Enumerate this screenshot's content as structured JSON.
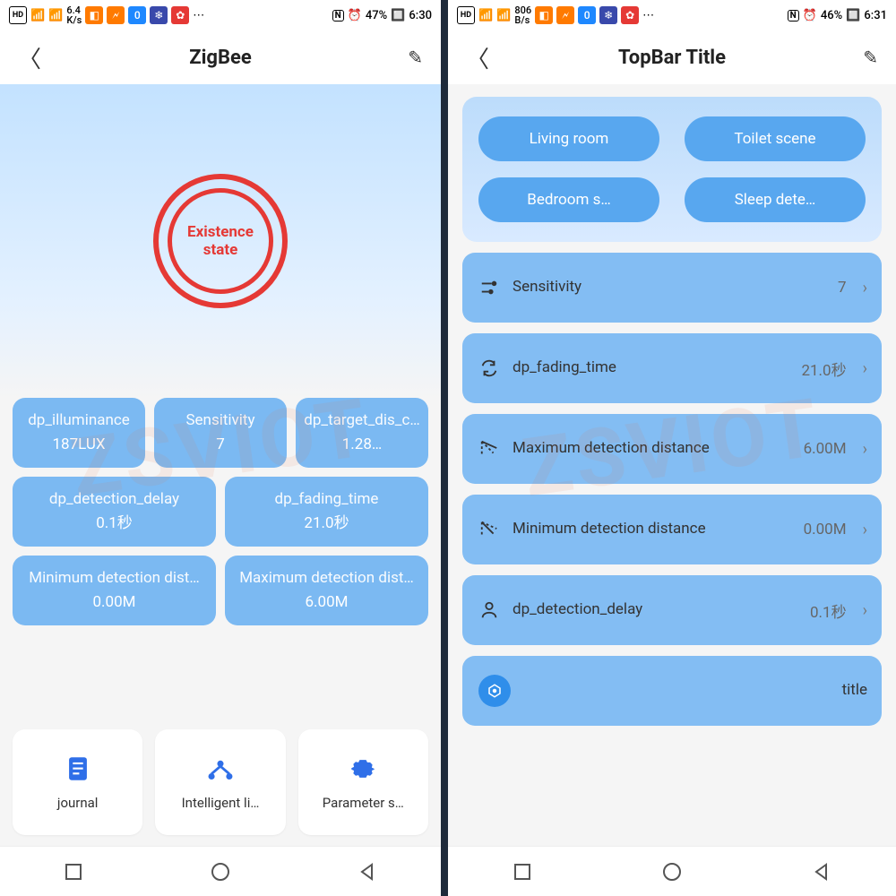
{
  "left": {
    "status": {
      "net": "6.4\nK/s",
      "battery": "47%",
      "time": "6:30"
    },
    "title": "ZigBee",
    "hero": "Existence state",
    "tiles": [
      [
        {
          "label": "dp_illuminance",
          "val": "187LUX"
        },
        {
          "label": "Sensitivity",
          "val": "7"
        },
        {
          "label": "dp_target_dis_c…",
          "val": "1.28…"
        }
      ],
      [
        {
          "label": "dp_detection_delay",
          "val": "0.1秒"
        },
        {
          "label": "dp_fading_time",
          "val": "21.0秒"
        }
      ],
      [
        {
          "label": "Minimum detection dist…",
          "val": "0.00M"
        },
        {
          "label": "Maximum detection dist…",
          "val": "6.00M"
        }
      ]
    ],
    "bottom": [
      {
        "name": "journal-card",
        "label": "journal"
      },
      {
        "name": "intelligent-card",
        "label": "Intelligent li…"
      },
      {
        "name": "parameter-card",
        "label": "Parameter s…"
      }
    ]
  },
  "right": {
    "status": {
      "net": "806\nB/s",
      "battery": "46%",
      "time": "6:31"
    },
    "title": "TopBar Title",
    "scenes": [
      "Living room",
      "Toilet scene",
      "Bedroom s…",
      "Sleep dete…"
    ],
    "rows": [
      {
        "name": "row-sensitivity",
        "label": "Sensitivity",
        "val": "7"
      },
      {
        "name": "row-fading-time",
        "label": "dp_fading_time",
        "val": "21.0秒"
      },
      {
        "name": "row-max-distance",
        "label": "Maximum detection distance",
        "val": "6.00M"
      },
      {
        "name": "row-min-distance",
        "label": "Minimum detection distance",
        "val": "0.00M"
      },
      {
        "name": "row-detection-delay",
        "label": "dp_detection_delay",
        "val": "0.1秒"
      }
    ],
    "title_row": {
      "label": "title"
    }
  },
  "watermark": "ZSVIOT"
}
